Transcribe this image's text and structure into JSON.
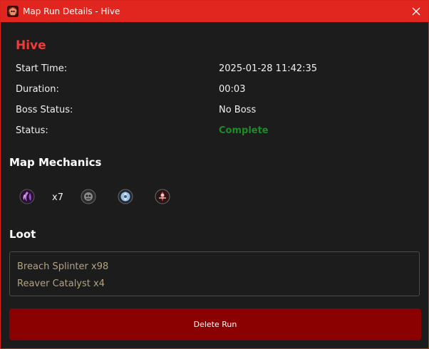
{
  "window": {
    "title": "Map Run Details - Hive",
    "accent_color": "#e0261e",
    "close_icon": "close-icon"
  },
  "map": {
    "name": "Hive",
    "name_color": "#ee3b3b"
  },
  "details": {
    "start_time_label": "Start Time:",
    "start_time_value": "2025-01-28 11:42:35",
    "duration_label": "Duration:",
    "duration_value": "00:03",
    "boss_status_label": "Boss Status:",
    "boss_status_value": "No Boss",
    "status_label": "Status:",
    "status_value": "Complete",
    "status_color": "#1f8a2a"
  },
  "mechanics": {
    "header": "Map Mechanics",
    "items": [
      {
        "icon": "breach-icon",
        "count": "x7"
      },
      {
        "icon": "ritual-icon"
      },
      {
        "icon": "delirium-icon"
      },
      {
        "icon": "expedition-icon"
      }
    ]
  },
  "loot": {
    "header": "Loot",
    "items": [
      "Breach Splinter x98",
      "Reaver Catalyst x4"
    ]
  },
  "actions": {
    "delete_label": "Delete Run",
    "delete_color": "#8b0000"
  }
}
